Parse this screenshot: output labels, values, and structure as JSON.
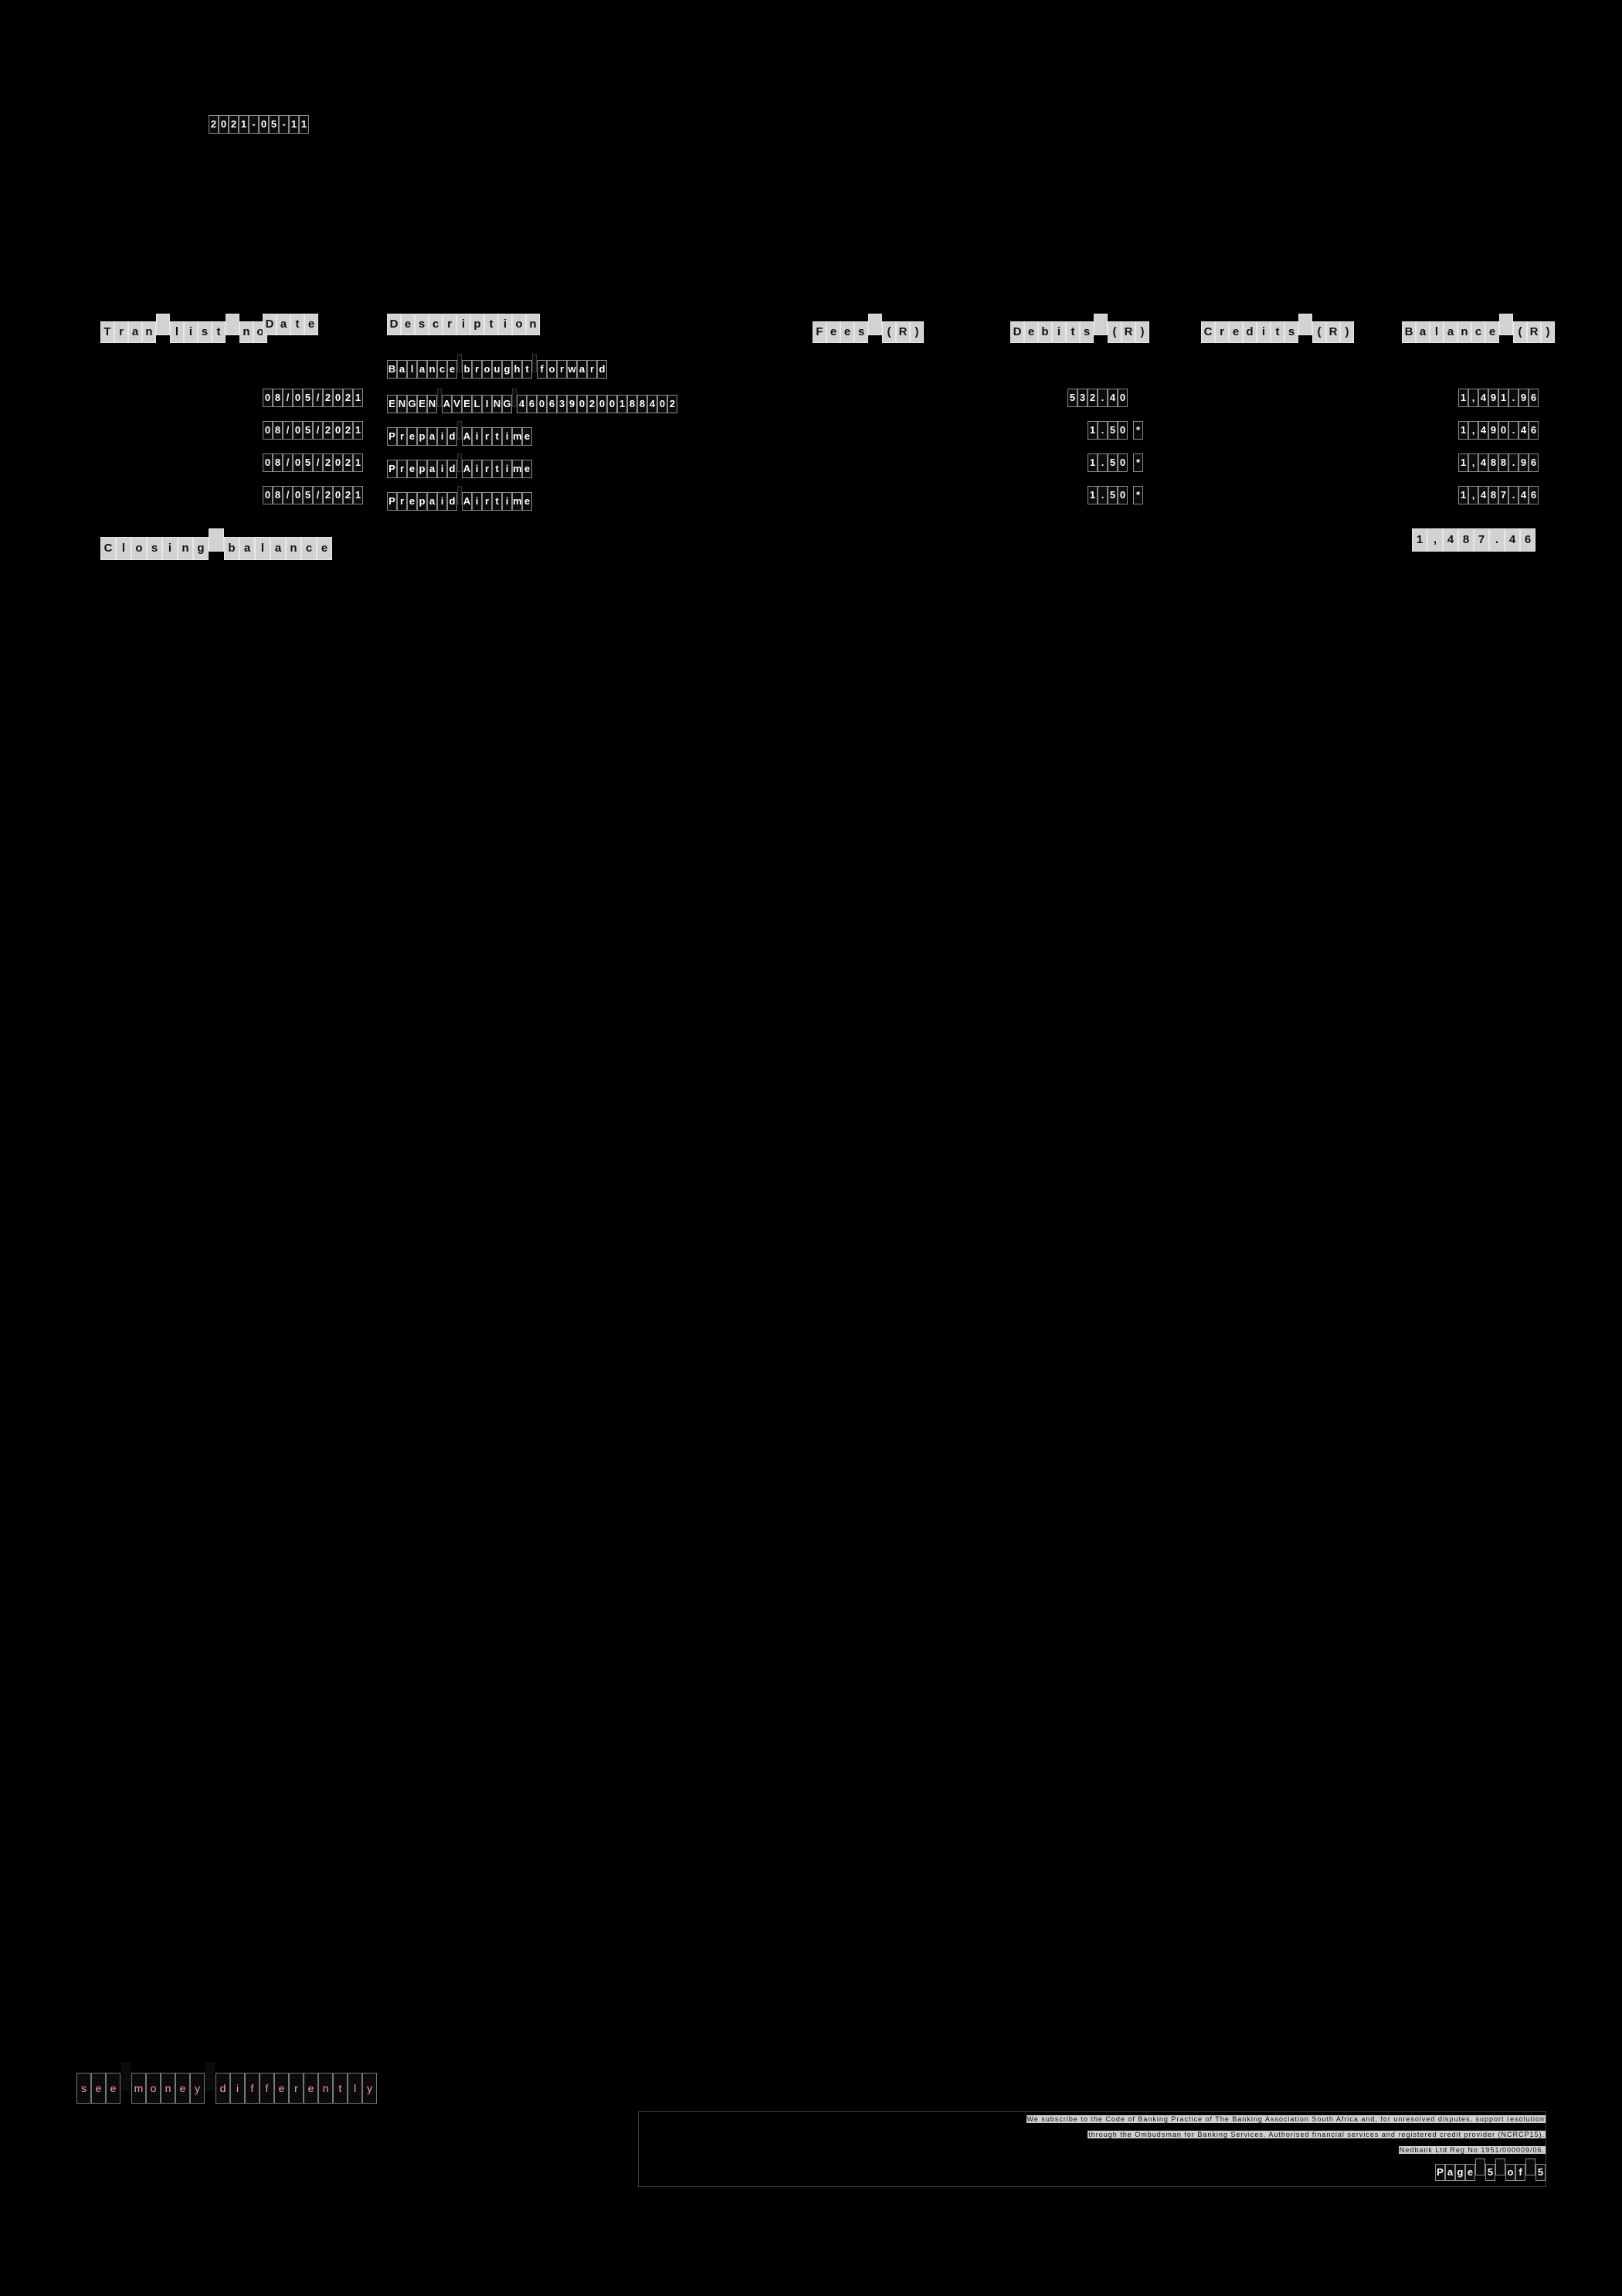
{
  "statement_date": "2021-05-11",
  "table": {
    "headers": {
      "tran_list_no": "Tran list no",
      "date": "Date",
      "description": "Description",
      "fees": "Fees (R)",
      "debits": "Debits (R)",
      "credits": "Credits (R)",
      "balance": "Balance (R)"
    },
    "rows": [
      {
        "date": "",
        "description": "Balance brought forward",
        "fees": "",
        "debit": "",
        "marker": "",
        "credit": "",
        "balance": ""
      },
      {
        "date": "08/05/2021",
        "description": "ENGEN AVELING 4606390200188402",
        "fees": "",
        "debit": "532.40",
        "marker": "",
        "credit": "",
        "balance": "1,491.96"
      },
      {
        "date": "08/05/2021",
        "description": "Prepaid Airtime",
        "fees": "",
        "debit": "1.50",
        "marker": "*",
        "credit": "",
        "balance": "1,490.46"
      },
      {
        "date": "08/05/2021",
        "description": "Prepaid Airtime",
        "fees": "",
        "debit": "1.50",
        "marker": "*",
        "credit": "",
        "balance": "1,488.96"
      },
      {
        "date": "08/05/2021",
        "description": "Prepaid Airtime",
        "fees": "",
        "debit": "1.50",
        "marker": "*",
        "credit": "",
        "balance": "1,487.46"
      }
    ],
    "closing": {
      "label": "Closing balance",
      "value": "1,487.46"
    }
  },
  "footer": {
    "tagline": "see money differently",
    "legal_lines": [
      "We subscribe to the Code of Banking Practice of The Banking Association South Africa and, for unresolved disputes, support resolution",
      "through the Ombudsman for Banking Services. Authorised financial services and registered credit provider (NCRCP15).",
      "Nedbank Ltd Reg No 1951/000009/06."
    ],
    "page": "Page 5 of 5"
  }
}
